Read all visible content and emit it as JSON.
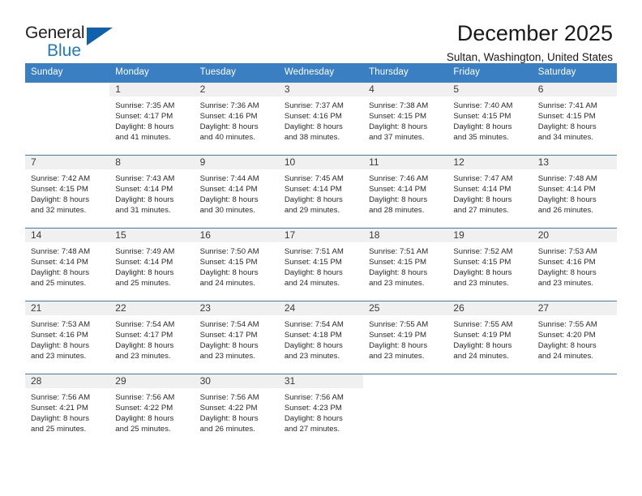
{
  "brand": {
    "name_part1": "General",
    "name_part2": "Blue",
    "triangle_color": "#1061ab",
    "blue_text_color": "#1f7ac1"
  },
  "header": {
    "title": "December 2025",
    "subtitle": "Sultan, Washington, United States"
  },
  "calendar": {
    "header_bg": "#3a7fc1",
    "daynum_bg": "#f0f0f0",
    "weekday_headers": [
      "Sunday",
      "Monday",
      "Tuesday",
      "Wednesday",
      "Thursday",
      "Friday",
      "Saturday"
    ],
    "weeks": [
      [
        {
          "day": "",
          "sunrise": "",
          "sunset": "",
          "daylight1": "",
          "daylight2": ""
        },
        {
          "day": "1",
          "sunrise": "Sunrise: 7:35 AM",
          "sunset": "Sunset: 4:17 PM",
          "daylight1": "Daylight: 8 hours",
          "daylight2": "and 41 minutes."
        },
        {
          "day": "2",
          "sunrise": "Sunrise: 7:36 AM",
          "sunset": "Sunset: 4:16 PM",
          "daylight1": "Daylight: 8 hours",
          "daylight2": "and 40 minutes."
        },
        {
          "day": "3",
          "sunrise": "Sunrise: 7:37 AM",
          "sunset": "Sunset: 4:16 PM",
          "daylight1": "Daylight: 8 hours",
          "daylight2": "and 38 minutes."
        },
        {
          "day": "4",
          "sunrise": "Sunrise: 7:38 AM",
          "sunset": "Sunset: 4:15 PM",
          "daylight1": "Daylight: 8 hours",
          "daylight2": "and 37 minutes."
        },
        {
          "day": "5",
          "sunrise": "Sunrise: 7:40 AM",
          "sunset": "Sunset: 4:15 PM",
          "daylight1": "Daylight: 8 hours",
          "daylight2": "and 35 minutes."
        },
        {
          "day": "6",
          "sunrise": "Sunrise: 7:41 AM",
          "sunset": "Sunset: 4:15 PM",
          "daylight1": "Daylight: 8 hours",
          "daylight2": "and 34 minutes."
        }
      ],
      [
        {
          "day": "7",
          "sunrise": "Sunrise: 7:42 AM",
          "sunset": "Sunset: 4:15 PM",
          "daylight1": "Daylight: 8 hours",
          "daylight2": "and 32 minutes."
        },
        {
          "day": "8",
          "sunrise": "Sunrise: 7:43 AM",
          "sunset": "Sunset: 4:14 PM",
          "daylight1": "Daylight: 8 hours",
          "daylight2": "and 31 minutes."
        },
        {
          "day": "9",
          "sunrise": "Sunrise: 7:44 AM",
          "sunset": "Sunset: 4:14 PM",
          "daylight1": "Daylight: 8 hours",
          "daylight2": "and 30 minutes."
        },
        {
          "day": "10",
          "sunrise": "Sunrise: 7:45 AM",
          "sunset": "Sunset: 4:14 PM",
          "daylight1": "Daylight: 8 hours",
          "daylight2": "and 29 minutes."
        },
        {
          "day": "11",
          "sunrise": "Sunrise: 7:46 AM",
          "sunset": "Sunset: 4:14 PM",
          "daylight1": "Daylight: 8 hours",
          "daylight2": "and 28 minutes."
        },
        {
          "day": "12",
          "sunrise": "Sunrise: 7:47 AM",
          "sunset": "Sunset: 4:14 PM",
          "daylight1": "Daylight: 8 hours",
          "daylight2": "and 27 minutes."
        },
        {
          "day": "13",
          "sunrise": "Sunrise: 7:48 AM",
          "sunset": "Sunset: 4:14 PM",
          "daylight1": "Daylight: 8 hours",
          "daylight2": "and 26 minutes."
        }
      ],
      [
        {
          "day": "14",
          "sunrise": "Sunrise: 7:48 AM",
          "sunset": "Sunset: 4:14 PM",
          "daylight1": "Daylight: 8 hours",
          "daylight2": "and 25 minutes."
        },
        {
          "day": "15",
          "sunrise": "Sunrise: 7:49 AM",
          "sunset": "Sunset: 4:14 PM",
          "daylight1": "Daylight: 8 hours",
          "daylight2": "and 25 minutes."
        },
        {
          "day": "16",
          "sunrise": "Sunrise: 7:50 AM",
          "sunset": "Sunset: 4:15 PM",
          "daylight1": "Daylight: 8 hours",
          "daylight2": "and 24 minutes."
        },
        {
          "day": "17",
          "sunrise": "Sunrise: 7:51 AM",
          "sunset": "Sunset: 4:15 PM",
          "daylight1": "Daylight: 8 hours",
          "daylight2": "and 24 minutes."
        },
        {
          "day": "18",
          "sunrise": "Sunrise: 7:51 AM",
          "sunset": "Sunset: 4:15 PM",
          "daylight1": "Daylight: 8 hours",
          "daylight2": "and 23 minutes."
        },
        {
          "day": "19",
          "sunrise": "Sunrise: 7:52 AM",
          "sunset": "Sunset: 4:15 PM",
          "daylight1": "Daylight: 8 hours",
          "daylight2": "and 23 minutes."
        },
        {
          "day": "20",
          "sunrise": "Sunrise: 7:53 AM",
          "sunset": "Sunset: 4:16 PM",
          "daylight1": "Daylight: 8 hours",
          "daylight2": "and 23 minutes."
        }
      ],
      [
        {
          "day": "21",
          "sunrise": "Sunrise: 7:53 AM",
          "sunset": "Sunset: 4:16 PM",
          "daylight1": "Daylight: 8 hours",
          "daylight2": "and 23 minutes."
        },
        {
          "day": "22",
          "sunrise": "Sunrise: 7:54 AM",
          "sunset": "Sunset: 4:17 PM",
          "daylight1": "Daylight: 8 hours",
          "daylight2": "and 23 minutes."
        },
        {
          "day": "23",
          "sunrise": "Sunrise: 7:54 AM",
          "sunset": "Sunset: 4:17 PM",
          "daylight1": "Daylight: 8 hours",
          "daylight2": "and 23 minutes."
        },
        {
          "day": "24",
          "sunrise": "Sunrise: 7:54 AM",
          "sunset": "Sunset: 4:18 PM",
          "daylight1": "Daylight: 8 hours",
          "daylight2": "and 23 minutes."
        },
        {
          "day": "25",
          "sunrise": "Sunrise: 7:55 AM",
          "sunset": "Sunset: 4:19 PM",
          "daylight1": "Daylight: 8 hours",
          "daylight2": "and 23 minutes."
        },
        {
          "day": "26",
          "sunrise": "Sunrise: 7:55 AM",
          "sunset": "Sunset: 4:19 PM",
          "daylight1": "Daylight: 8 hours",
          "daylight2": "and 24 minutes."
        },
        {
          "day": "27",
          "sunrise": "Sunrise: 7:55 AM",
          "sunset": "Sunset: 4:20 PM",
          "daylight1": "Daylight: 8 hours",
          "daylight2": "and 24 minutes."
        }
      ],
      [
        {
          "day": "28",
          "sunrise": "Sunrise: 7:56 AM",
          "sunset": "Sunset: 4:21 PM",
          "daylight1": "Daylight: 8 hours",
          "daylight2": "and 25 minutes."
        },
        {
          "day": "29",
          "sunrise": "Sunrise: 7:56 AM",
          "sunset": "Sunset: 4:22 PM",
          "daylight1": "Daylight: 8 hours",
          "daylight2": "and 25 minutes."
        },
        {
          "day": "30",
          "sunrise": "Sunrise: 7:56 AM",
          "sunset": "Sunset: 4:22 PM",
          "daylight1": "Daylight: 8 hours",
          "daylight2": "and 26 minutes."
        },
        {
          "day": "31",
          "sunrise": "Sunrise: 7:56 AM",
          "sunset": "Sunset: 4:23 PM",
          "daylight1": "Daylight: 8 hours",
          "daylight2": "and 27 minutes."
        },
        {
          "day": "",
          "sunrise": "",
          "sunset": "",
          "daylight1": "",
          "daylight2": ""
        },
        {
          "day": "",
          "sunrise": "",
          "sunset": "",
          "daylight1": "",
          "daylight2": ""
        },
        {
          "day": "",
          "sunrise": "",
          "sunset": "",
          "daylight1": "",
          "daylight2": ""
        }
      ]
    ]
  }
}
